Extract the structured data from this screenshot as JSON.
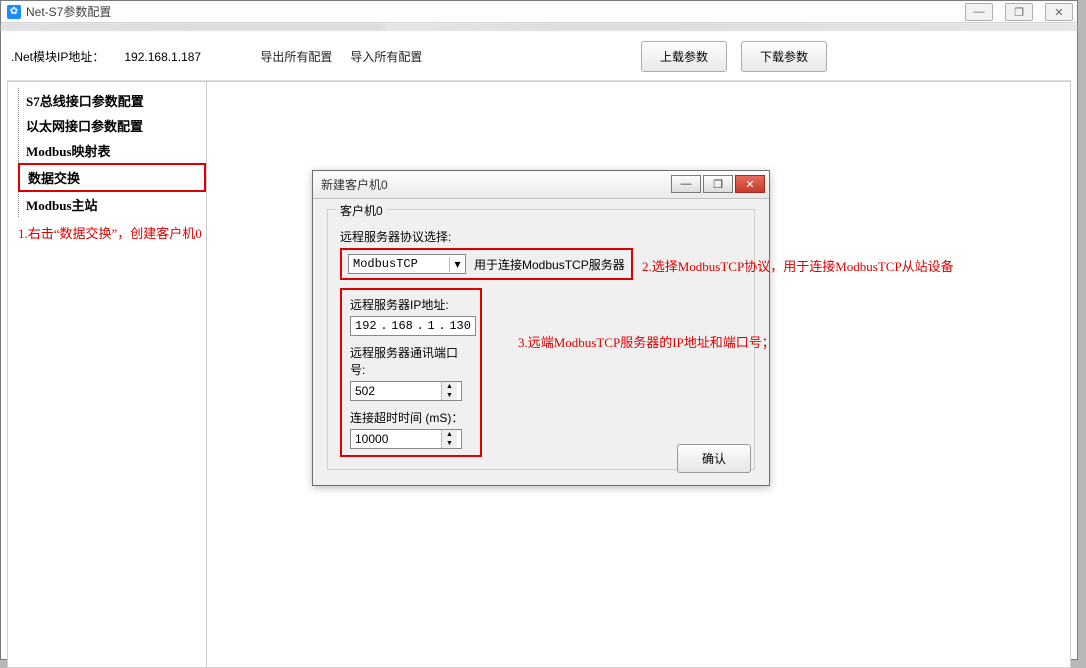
{
  "window": {
    "title": "Net-S7参数配置"
  },
  "topbar": {
    "ip_label": ".Net模块IP地址：",
    "ip_value": "192.168.1.187",
    "export_label": "导出所有配置",
    "import_label": "导入所有配置",
    "upload_label": "上载参数",
    "download_label": "下载参数"
  },
  "win_controls": {
    "min": "—",
    "max": "❐",
    "close": "✕"
  },
  "nav": {
    "items": [
      "S7总线接口参数配置",
      "以太网接口参数配置",
      "Modbus映射表",
      "数据交换",
      "Modbus主站"
    ],
    "selected_index": 3
  },
  "annotations": {
    "a1": "1.右击“数据交换”，创建客户机0",
    "a2": "2.选择ModbusTCP协议，用于连接ModbusTCP从站设备",
    "a3": "3.远端ModbusTCP服务器的IP地址和端口号；"
  },
  "dialog": {
    "title": "新建客户机0",
    "group_legend": "客户机0",
    "protocol_label": "远程服务器协议选择:",
    "protocol_value": "ModbusTCP",
    "protocol_hint": "用于连接ModbusTCP服务器",
    "ip_label": "远程服务器IP地址:",
    "ip_parts": [
      "192",
      "168",
      "1",
      "130"
    ],
    "port_label": "远程服务器通讯端口号:",
    "port_value": "502",
    "timeout_label": "连接超时时间 (mS)：",
    "timeout_value": "10000",
    "ok_label": "确认",
    "wc": {
      "min": "—",
      "max": "❐",
      "close": "✕"
    }
  }
}
